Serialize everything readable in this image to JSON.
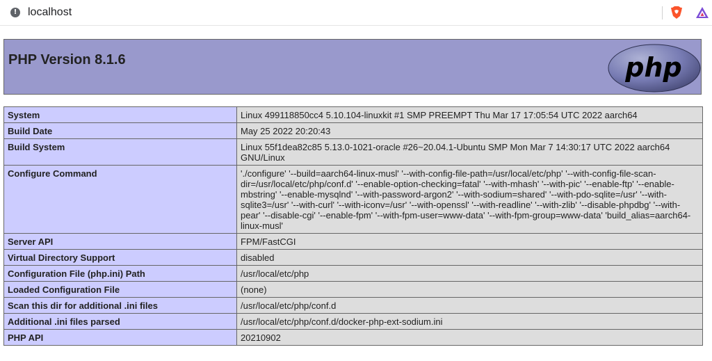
{
  "browser": {
    "url": "localhost",
    "info_icon": "info-icon",
    "brave_icon": "brave-shield-icon",
    "rewards_icon": "brave-rewards-icon"
  },
  "header": {
    "title": "PHP Version 8.1.6",
    "logo_text": "php"
  },
  "rows": [
    {
      "label": "System",
      "value": "Linux 499118850cc4 5.10.104-linuxkit #1 SMP PREEMPT Thu Mar 17 17:05:54 UTC 2022 aarch64"
    },
    {
      "label": "Build Date",
      "value": "May 25 2022 20:20:43"
    },
    {
      "label": "Build System",
      "value": "Linux 55f1dea82c85 5.13.0-1021-oracle #26~20.04.1-Ubuntu SMP Mon Mar 7 14:30:17 UTC 2022 aarch64 GNU/Linux"
    },
    {
      "label": "Configure Command",
      "value": "'./configure' '--build=aarch64-linux-musl' '--with-config-file-path=/usr/local/etc/php' '--with-config-file-scan-dir=/usr/local/etc/php/conf.d' '--enable-option-checking=fatal' '--with-mhash' '--with-pic' '--enable-ftp' '--enable-mbstring' '--enable-mysqlnd' '--with-password-argon2' '--with-sodium=shared' '--with-pdo-sqlite=/usr' '--with-sqlite3=/usr' '--with-curl' '--with-iconv=/usr' '--with-openssl' '--with-readline' '--with-zlib' '--disable-phpdbg' '--with-pear' '--disable-cgi' '--enable-fpm' '--with-fpm-user=www-data' '--with-fpm-group=www-data' 'build_alias=aarch64-linux-musl'"
    },
    {
      "label": "Server API",
      "value": "FPM/FastCGI"
    },
    {
      "label": "Virtual Directory Support",
      "value": "disabled"
    },
    {
      "label": "Configuration File (php.ini) Path",
      "value": "/usr/local/etc/php"
    },
    {
      "label": "Loaded Configuration File",
      "value": "(none)"
    },
    {
      "label": "Scan this dir for additional .ini files",
      "value": "/usr/local/etc/php/conf.d"
    },
    {
      "label": "Additional .ini files parsed",
      "value": "/usr/local/etc/php/conf.d/docker-php-ext-sodium.ini"
    },
    {
      "label": "PHP API",
      "value": "20210902"
    }
  ]
}
